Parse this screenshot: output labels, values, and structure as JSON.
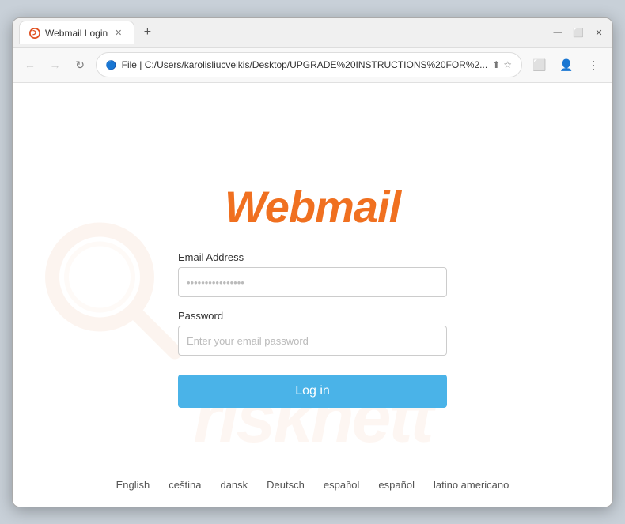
{
  "browser": {
    "tab_title": "Webmail Login",
    "url": "File  |  C:/Users/karolisliucveikis/Desktop/UPGRADE%20INSTRUCTIONS%20FOR%2...",
    "url_short": "File  |  C:/Users/karolisliucveikis/Desktop/UPGRADE%20INSTRUCTIONS%20FOR%2..."
  },
  "page": {
    "logo": "Webmail",
    "email_label": "Email Address",
    "email_placeholder": "••••••••••••••••••",
    "password_label": "Password",
    "password_placeholder": "Enter your email password",
    "login_button": "Log in"
  },
  "languages": [
    "English",
    "ceština",
    "dansk",
    "Deutsch",
    "español",
    "español",
    "latino americano"
  ]
}
